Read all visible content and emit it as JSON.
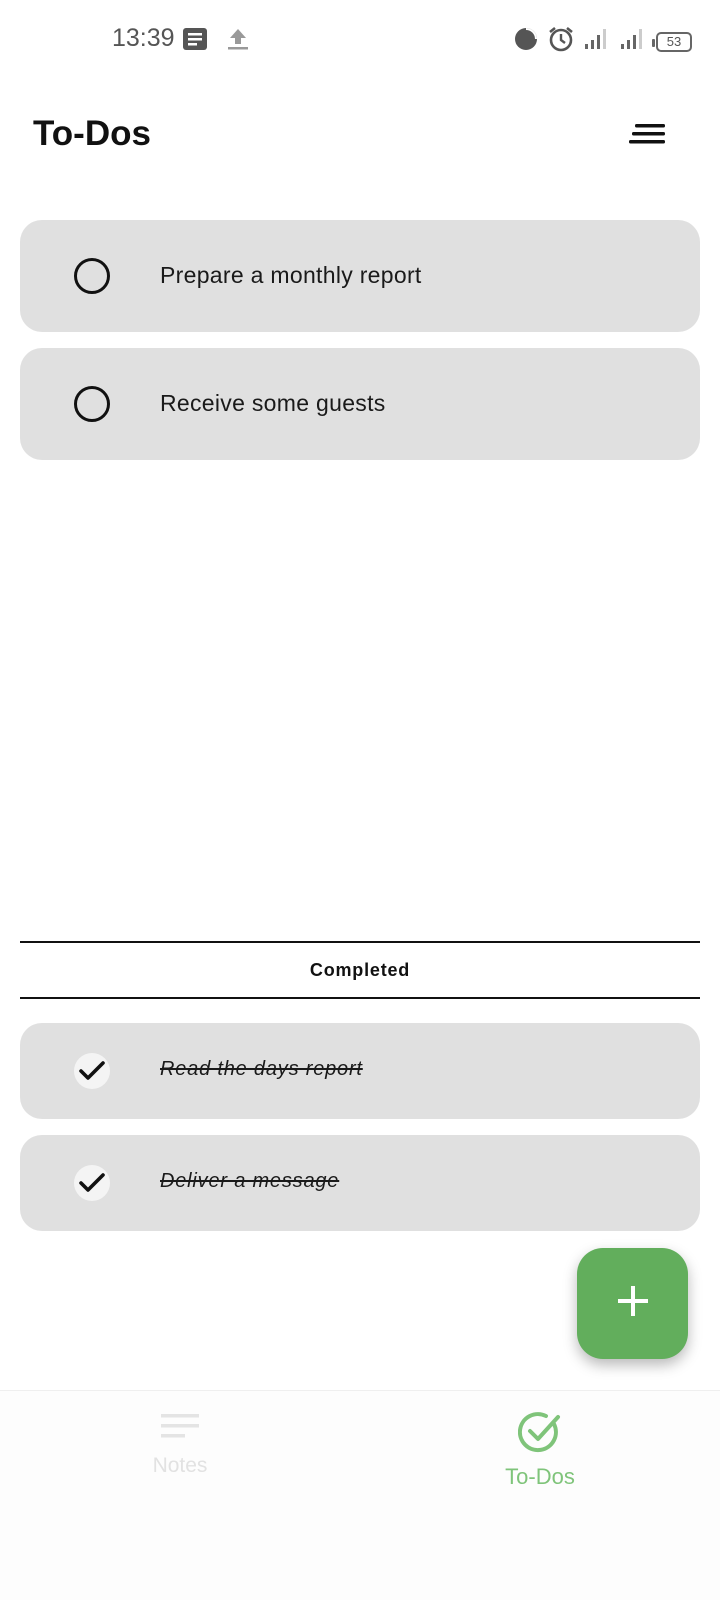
{
  "status_bar": {
    "time": "13:39",
    "battery": "53",
    "left_icons": [
      "message-icon",
      "upload-icon"
    ],
    "right_icons": [
      "data-saver-icon",
      "alarm-icon",
      "signal-icon",
      "signal-icon",
      "battery-icon"
    ]
  },
  "header": {
    "title": "To-Dos",
    "sort_icon": "sort-icon"
  },
  "todos": [
    {
      "label": "Prepare a monthly report",
      "completed": false
    },
    {
      "label": "Receive some guests",
      "completed": false
    }
  ],
  "completed_section": {
    "label": "Completed",
    "items": [
      {
        "label": "Read the days report",
        "completed": true
      },
      {
        "label": "Deliver a message",
        "completed": true
      }
    ]
  },
  "fab": {
    "icon": "plus-icon"
  },
  "bottom_nav": {
    "items": [
      {
        "label": "Notes",
        "icon": "notes-icon",
        "active": false
      },
      {
        "label": "To-Dos",
        "icon": "check-circle-icon",
        "active": true
      }
    ]
  },
  "colors": {
    "accent": "#62ae5c",
    "accent_light": "#7fc47a",
    "card_bg": "#e0e0e0",
    "inactive_nav": "#e2e2e2"
  }
}
